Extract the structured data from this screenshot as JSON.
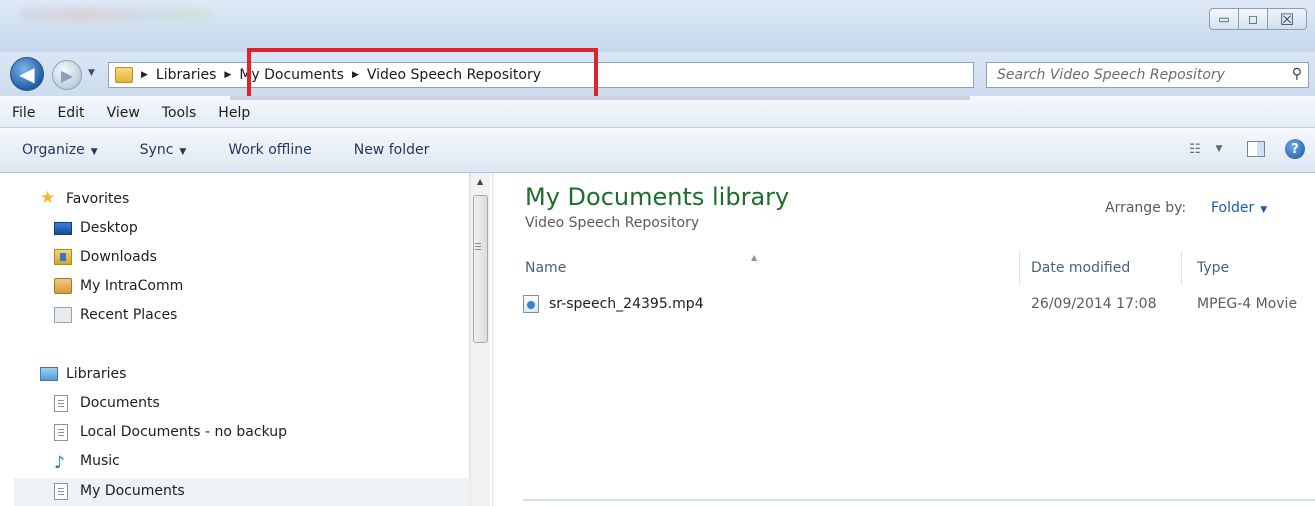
{
  "window": {
    "buttons": {
      "minimize": "▭",
      "maximize": "◻",
      "close": "☒"
    }
  },
  "address": {
    "breadcrumb": [
      "Libraries",
      "My Documents",
      "Video Speech Repository"
    ],
    "search_placeholder": "Search Video Speech Repository"
  },
  "menu": [
    "File",
    "Edit",
    "View",
    "Tools",
    "Help"
  ],
  "commands": {
    "organize": "Organize",
    "sync": "Sync",
    "work_offline": "Work offline",
    "new_folder": "New folder"
  },
  "nav": {
    "favorites": {
      "label": "Favorites",
      "items": [
        "Desktop",
        "Downloads",
        "My IntraComm",
        "Recent Places"
      ]
    },
    "libraries": {
      "label": "Libraries",
      "items": [
        "Documents",
        "Local Documents - no backup",
        "Music",
        "My Documents"
      ]
    }
  },
  "content": {
    "library_title": "My Documents library",
    "library_subtitle": "Video Speech Repository",
    "arrange_label": "Arrange by:",
    "arrange_value": "Folder",
    "columns": {
      "name": "Name",
      "date": "Date modified",
      "type": "Type"
    },
    "files": [
      {
        "name": "sr-speech_24395.mp4",
        "date": "26/09/2014 17:08",
        "type": "MPEG-4 Movie"
      }
    ]
  },
  "colors": {
    "highlight": "#e0212e",
    "library_title": "#1e6e2a",
    "link": "#1d5ab1"
  }
}
